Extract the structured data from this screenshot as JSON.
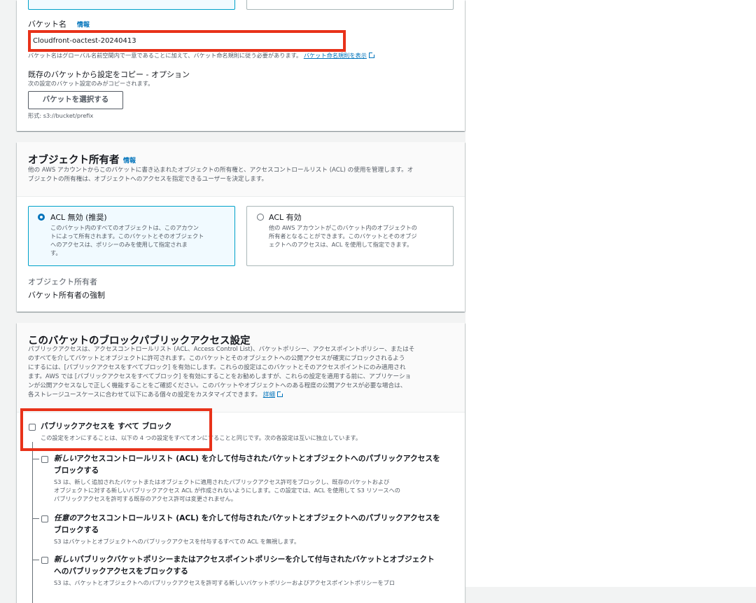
{
  "bucket_name": {
    "label": "バケット名",
    "info": "情報",
    "value": "Cloudfront-oactest-20240413",
    "hint": "バケット名はグローバル名前空間内で一意であることに加えて、バケット命名規則に従う必要があります。",
    "rules_link": "バケット命名規則を表示"
  },
  "copy_settings": {
    "title": "既存のバケットから設定をコピー - オプション",
    "desc": "次の設定のバケット設定のみがコピーされます。",
    "button": "バケットを選択する",
    "format": "形式: s3://bucket/prefix"
  },
  "ownership": {
    "title": "オブジェクト所有者",
    "info": "情報",
    "desc_1": "他の AWS アカウントからこのバケットに書き込まれたオブジェクトの所有権と、アクセスコントロールリスト (ACL) の使用を管理します。オ",
    "desc_2": "ブジェクトの所有権は、オブジェクトへのアクセスを指定できるユーザーを決定します。",
    "options": [
      {
        "label": "ACL 無効 (推奨)",
        "lines": [
          "このバケット内のすべてのオブジェクトは、このアカウン",
          "トによって所有されます。このバケットとそのオブジェクト",
          "へのアクセスは、ポリシーのみを使用して指定されま",
          "す。"
        ],
        "selected": true
      },
      {
        "label": "ACL 有効",
        "lines": [
          "他の AWS アカウントがこのバケット内のオブジェクトの",
          "所有者となることができます。このバケットとそのオブジ",
          "ェクトへのアクセスは、ACL を使用して指定できます。"
        ],
        "selected": false
      }
    ],
    "owner_label": "オブジェクト所有者",
    "owner_value": "バケット所有者の強制"
  },
  "block_public": {
    "title": "このバケットのブロックパブリックアクセス設定",
    "desc_lines": [
      "パブリックアクセスは、アクセスコントロールリスト (ACL、Access Control List)、バケットポリシー、アクセスポイントポリシー、またはそ",
      "のすべてを介してバケットとオブジェクトに許可されます。このバケットとそのオブジェクトへの公開アクセスが確実にブロックされるよう",
      "にするには、[パブリックアクセスをすべてブロック] を有効にします。これらの設定はこのバケットとそのアクセスポイントにのみ適用され",
      "ます。AWS では [パブリックアクセスをすべてブロック] を有効にすることをお勧めしますが、これらの設定を適用する前に、アプリケーショ",
      "ンが公開アクセスなしで正しく機能することをご確認ください。このバケットやオブジェクトへのある程度の公開アクセスが必要な場合は、",
      "各ストレージユースケースに合わせて以下にある個々の設定をカスタマイズできます。"
    ],
    "details_link": "詳細",
    "block_all_label": "パブリックアクセスを すべて ブロック",
    "block_all_desc": "この設定をオンにすることは、以下の 4 つの設定をすべてオンにすることと同じです。次の各設定は互いに独立しています。",
    "options": [
      {
        "emph": "新しい",
        "title_1": "アクセスコントロールリスト (ACL) を介して付与されたバケットとオブジェクトへのパブリックアクセスを",
        "title_2": "ブロックする",
        "desc": [
          "S3 は、新しく追加されたバケットまたはオブジェクトに適用されたパブリックアクセス許可をブロックし、既存のバケットおよび",
          "オブジェクトに対する新しいパブリックアクセス ACL が作成されないようにします。この設定では、ACL を使用して S3 リソースへの",
          "パブリックアクセスを許可する既存のアクセス許可は変更されません。"
        ]
      },
      {
        "emph": "任意の",
        "title_1": "アクセスコントロールリスト (ACL) を介して付与されたバケットとオブジェクトへのパブリックアクセスを",
        "title_2": "ブロックする",
        "desc": [
          "S3 はバケットとオブジェクトへのパブリックアクセスを付与するすべての ACL を無視します。"
        ]
      },
      {
        "emph": "新しい",
        "title_1": "パブリックバケットポリシーまたはアクセスポイントポリシーを介して付与されたバケットとオブジェクト",
        "title_2": "へのパブリックアクセスをブロックする",
        "desc": [
          "S3 は、バケットとオブジェクトへのパブリックアクセスを許可する新しいバケットポリシーおよびアクセスポイントポリシーをブロ"
        ]
      }
    ]
  },
  "colors": {
    "highlight": "#e8321a",
    "link": "#0073bb",
    "selected_border": "#00a1c9",
    "selected_bg": "#f1faff"
  }
}
